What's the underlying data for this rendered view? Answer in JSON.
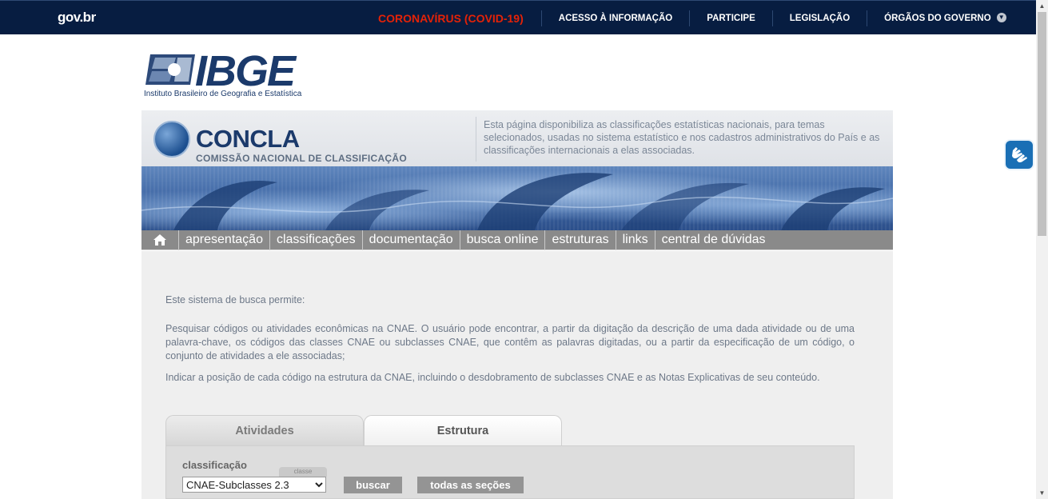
{
  "govbar": {
    "logo": "gov.br",
    "links": [
      {
        "label": "CORONAVÍRUS (COVID-19)",
        "name": "govbar-link-covid"
      },
      {
        "label": "ACESSO À INFORMAÇÃO",
        "name": "govbar-link-acesso"
      },
      {
        "label": "PARTICIPE",
        "name": "govbar-link-participe"
      },
      {
        "label": "LEGISLAÇÃO",
        "name": "govbar-link-legislacao"
      },
      {
        "label": "ÓRGÃOS DO GOVERNO",
        "name": "govbar-link-orgaos"
      }
    ]
  },
  "ibge": {
    "wordmark": "IBGE",
    "subtitle": "Instituto Brasileiro de Geografia e Estatística"
  },
  "concla": {
    "title": "CONCLA",
    "subtitle": "COMISSÃO NACIONAL DE CLASSIFICAÇÃO",
    "description": "Esta página disponibiliza as classificações estatísticas nacionais, para temas selecionados, usadas no sistema estatístico e nos cadastros administrativos do País e as classificações internacionais a elas associadas."
  },
  "nav": {
    "items": [
      "apresentação",
      "classificações",
      "documentação",
      "busca online",
      "estruturas",
      "links",
      "central de dúvidas"
    ]
  },
  "intro": {
    "p1": "Este sistema de busca permite:",
    "p2": "Pesquisar códigos ou atividades econômicas na CNAE. O usuário pode encontrar, a partir da digitação da descrição de uma dada atividade ou de uma palavra-chave, os códigos das classes CNAE ou subclasses CNAE, que contêm as palavras digitadas, ou a partir da especificação de um código, o conjunto de atividades a ele associadas;",
    "p3": "Indicar a posição de cada código na estrutura da CNAE, incluindo o desdobramento de subclasses CNAE e as Notas Explicativas de seu conteúdo."
  },
  "tabs": [
    {
      "label": "Atividades",
      "active": false
    },
    {
      "label": "Estrutura",
      "active": true
    }
  ],
  "search": {
    "label": "classificação",
    "mini_tag": "classe",
    "selected": "CNAE-Subclasses 2.3",
    "buscar": "buscar",
    "todas": "todas as seções"
  },
  "colors": {
    "govbar_bg": "#071d41",
    "covid": "#e52207",
    "nav_bg": "#8a8a8a",
    "ibge_blue": "#1b3a6b",
    "button_gray": "#949494"
  }
}
